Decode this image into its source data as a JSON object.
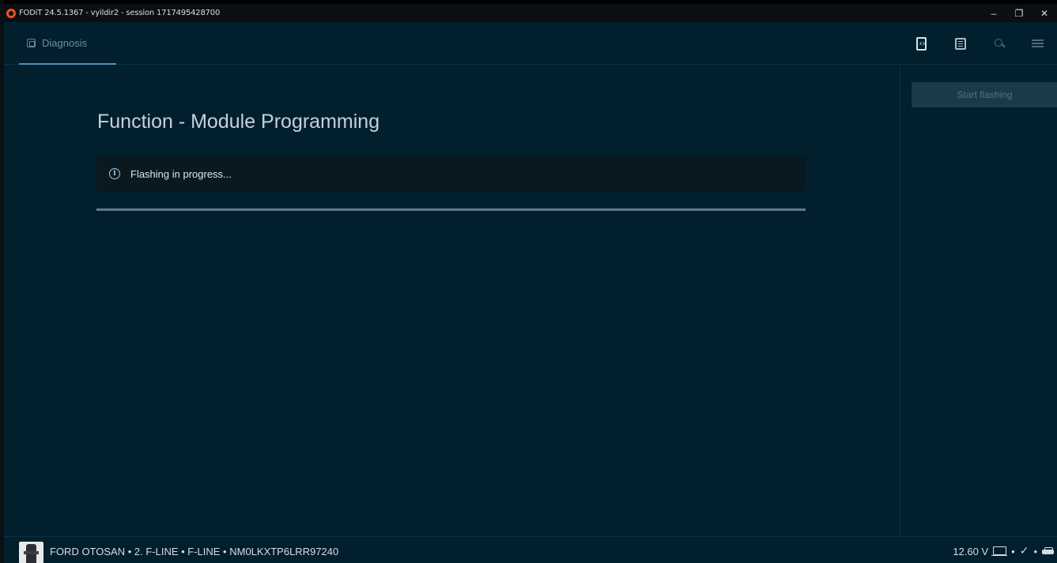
{
  "window": {
    "title": "FODiT 24.5.1367 - vyildir2 - session 1717495428700",
    "minimize": "–",
    "restore": "❐",
    "close": "✕"
  },
  "nav": {
    "tabs": [
      {
        "label": "Diagnosis",
        "icon": "chip-icon",
        "active": true
      }
    ],
    "icons": [
      "code-icon",
      "list-icon",
      "search-icon",
      "menu-icon"
    ]
  },
  "main": {
    "title": "Function - Module Programming",
    "info_message": "Flashing in progress...",
    "progress": 1.0
  },
  "side_panel": {
    "start_button": "Start flashing"
  },
  "status": {
    "vehicle": "FORD OTOSAN • 2. F-LINE • F-LINE • NM0LKXTP6LRR97240",
    "voltage": "12.60 V",
    "separator": "•",
    "check": "✓"
  },
  "colors": {
    "background": "#021f2e",
    "titlebar": "#0b0f12",
    "accent": "#4b92b8",
    "info_box": "#0a1820",
    "button_disabled": "#1a3a4a"
  }
}
